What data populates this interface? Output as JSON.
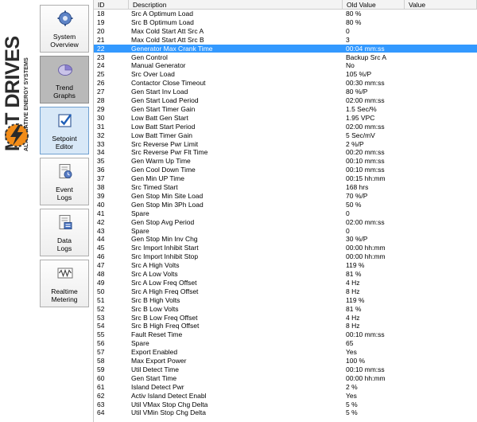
{
  "brand": {
    "name": "MLT DRIVES",
    "tagline": "ALTERNATIVE ENERGY SYSTEMS"
  },
  "nav": [
    {
      "id": "system-overview",
      "label_1": "System",
      "label_2": "Overview",
      "icon": "gear-icon"
    },
    {
      "id": "trend-graphs",
      "label_1": "Trend",
      "label_2": "Graphs",
      "icon": "pie-chart-icon"
    },
    {
      "id": "setpoint-editor",
      "label_1": "Setpoint",
      "label_2": "Editor",
      "icon": "checklist-icon"
    },
    {
      "id": "event-logs",
      "label_1": "Event",
      "label_2": "Logs",
      "icon": "clock-document-icon"
    },
    {
      "id": "data-logs",
      "label_1": "Data",
      "label_2": "Logs",
      "icon": "data-document-icon"
    },
    {
      "id": "realtime-metering",
      "label_1": "Realtime",
      "label_2": "Metering",
      "icon": "waveform-icon"
    }
  ],
  "table": {
    "columns": {
      "id": "ID",
      "description": "Description",
      "old_value": "Old Value",
      "value": "Value"
    },
    "selected_row_id": "22",
    "rows": [
      {
        "id": "18",
        "desc": "Src A Optimum Load",
        "old": "80 %",
        "val": ""
      },
      {
        "id": "19",
        "desc": "Src B Optimum Load",
        "old": "80 %",
        "val": ""
      },
      {
        "id": "20",
        "desc": "Max Cold Start Att Src A",
        "old": "0",
        "val": ""
      },
      {
        "id": "21",
        "desc": "Max Cold Start Att Src B",
        "old": "3",
        "val": ""
      },
      {
        "id": "22",
        "desc": "Generator Max Crank Time",
        "old": "00:04 mm:ss",
        "val": ""
      },
      {
        "id": "23",
        "desc": "Gen Control",
        "old": "Backup Src A",
        "val": ""
      },
      {
        "id": "24",
        "desc": "Manual Generator",
        "old": "No",
        "val": ""
      },
      {
        "id": "25",
        "desc": "Src Over Load",
        "old": "105 %/P",
        "val": ""
      },
      {
        "id": "26",
        "desc": "Contactor Close Timeout",
        "old": "00:30 mm:ss",
        "val": ""
      },
      {
        "id": "27",
        "desc": "Gen Start Inv Load",
        "old": "80 %/P",
        "val": ""
      },
      {
        "id": "28",
        "desc": "Gen Start Load Period",
        "old": "02:00 mm:ss",
        "val": ""
      },
      {
        "id": "29",
        "desc": "Gen Start Timer Gain",
        "old": "1.5 Sec/%",
        "val": ""
      },
      {
        "id": "30",
        "desc": "Low Batt Gen Start",
        "old": "1.95 VPC",
        "val": ""
      },
      {
        "id": "31",
        "desc": "Low Batt Start Period",
        "old": "02:00 mm:ss",
        "val": ""
      },
      {
        "id": "32",
        "desc": "Low Batt Timer Gain",
        "old": "5 Sec/mV",
        "val": ""
      },
      {
        "id": "33",
        "desc": "Src Reverse Pwr Limit",
        "old": "2 %/P",
        "val": ""
      },
      {
        "id": "34",
        "desc": "Src Reverse Pwr Flt Time",
        "old": "00:20 mm:ss",
        "val": ""
      },
      {
        "id": "35",
        "desc": "Gen Warm Up Time",
        "old": "00:10 mm:ss",
        "val": ""
      },
      {
        "id": "36",
        "desc": "Gen Cool Down Time",
        "old": "00:10 mm:ss",
        "val": ""
      },
      {
        "id": "37",
        "desc": "Gen Min UP Time",
        "old": "00:15 hh:mm",
        "val": ""
      },
      {
        "id": "38",
        "desc": "Src Timed Start",
        "old": "168 hrs",
        "val": ""
      },
      {
        "id": "39",
        "desc": "Gen Stop Min Site Load",
        "old": "70 %/P",
        "val": ""
      },
      {
        "id": "40",
        "desc": "Gen Stop Min 3Ph Load",
        "old": "50 %",
        "val": ""
      },
      {
        "id": "41",
        "desc": "Spare",
        "old": "0",
        "val": ""
      },
      {
        "id": "42",
        "desc": "Gen Stop Avg Period",
        "old": "02:00 mm:ss",
        "val": ""
      },
      {
        "id": "43",
        "desc": "Spare",
        "old": "0",
        "val": ""
      },
      {
        "id": "44",
        "desc": "Gen Stop Min Inv Chg",
        "old": "30 %/P",
        "val": ""
      },
      {
        "id": "45",
        "desc": "Src Import Inhibit Start",
        "old": "00:00 hh:mm",
        "val": ""
      },
      {
        "id": "46",
        "desc": "Src Import Inhibit Stop",
        "old": "00:00 hh:mm",
        "val": ""
      },
      {
        "id": "47",
        "desc": "Src A High Volts",
        "old": "119 %",
        "val": ""
      },
      {
        "id": "48",
        "desc": "Src A Low Volts",
        "old": "81 %",
        "val": ""
      },
      {
        "id": "49",
        "desc": "Src A Low Freq Offset",
        "old": "4 Hz",
        "val": ""
      },
      {
        "id": "50",
        "desc": "Src A High Freq Offset",
        "old": "8 Hz",
        "val": ""
      },
      {
        "id": "51",
        "desc": "Src B High Volts",
        "old": "119 %",
        "val": ""
      },
      {
        "id": "52",
        "desc": "Src B Low Volts",
        "old": "81 %",
        "val": ""
      },
      {
        "id": "53",
        "desc": "Src B Low Freq Offset",
        "old": "4 Hz",
        "val": ""
      },
      {
        "id": "54",
        "desc": "Src B High Freq Offset",
        "old": "8 Hz",
        "val": ""
      },
      {
        "id": "55",
        "desc": "Fault Reset Time",
        "old": "00:10 mm:ss",
        "val": ""
      },
      {
        "id": "56",
        "desc": "Spare",
        "old": "65",
        "val": ""
      },
      {
        "id": "57",
        "desc": "Export Enabled",
        "old": "Yes",
        "val": ""
      },
      {
        "id": "58",
        "desc": "Max Export Power",
        "old": "100 %",
        "val": ""
      },
      {
        "id": "59",
        "desc": "Util Detect Time",
        "old": "00:10 mm:ss",
        "val": ""
      },
      {
        "id": "60",
        "desc": "Gen Start Time",
        "old": "00:00 hh:mm",
        "val": ""
      },
      {
        "id": "61",
        "desc": "Island Detect Pwr",
        "old": "2 %",
        "val": ""
      },
      {
        "id": "62",
        "desc": "Activ Island Detect Enabl",
        "old": "Yes",
        "val": ""
      },
      {
        "id": "63",
        "desc": "Util VMax Stop Chg Delta",
        "old": "5 %",
        "val": ""
      },
      {
        "id": "64",
        "desc": "Util VMin Stop Chg Delta",
        "old": "5 %",
        "val": ""
      }
    ]
  },
  "colors": {
    "selection": "#3399ff",
    "brand_text": "#2b2b2b",
    "logo": "#f28c18"
  }
}
